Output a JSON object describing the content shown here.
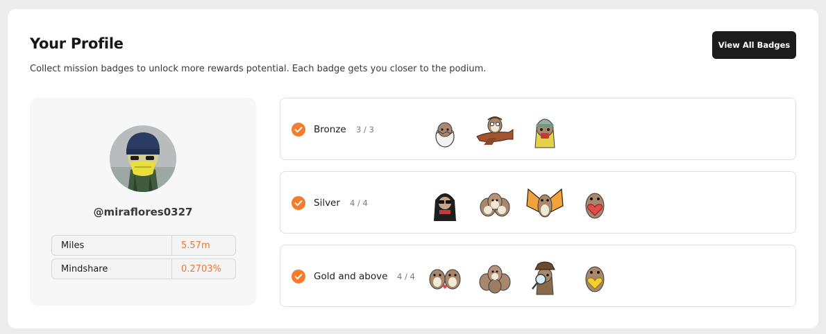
{
  "header": {
    "title": "Your Profile",
    "subtitle": "Collect mission badges to unlock more rewards potential. Each badge gets you closer to the podium.",
    "view_all_label": "View All Badges"
  },
  "profile": {
    "username": "@miraflores0327",
    "stats": [
      {
        "label": "Miles",
        "value": "5.57m"
      },
      {
        "label": "Mindshare",
        "value": "0.2703%"
      }
    ]
  },
  "tiers": [
    {
      "name": "Bronze",
      "count": "3 / 3",
      "badges": [
        "egg-owl-badge",
        "airplane-owl-badge",
        "beanie-owl-badge"
      ]
    },
    {
      "name": "Silver",
      "count": "4 / 4",
      "badges": [
        "hooded-owl-badge",
        "owl-group-badge",
        "butterfly-owl-badge",
        "heart-owl-badge"
      ]
    },
    {
      "name": "Gold and above",
      "count": "4 / 4",
      "badges": [
        "owl-trio-badge",
        "owl-crowd-badge",
        "detective-owl-badge",
        "gold-heart-owl-badge"
      ]
    }
  ],
  "colors": {
    "accent": "#f47c2c",
    "stat_value": "#f0732a",
    "button": "#1c1c1c"
  }
}
